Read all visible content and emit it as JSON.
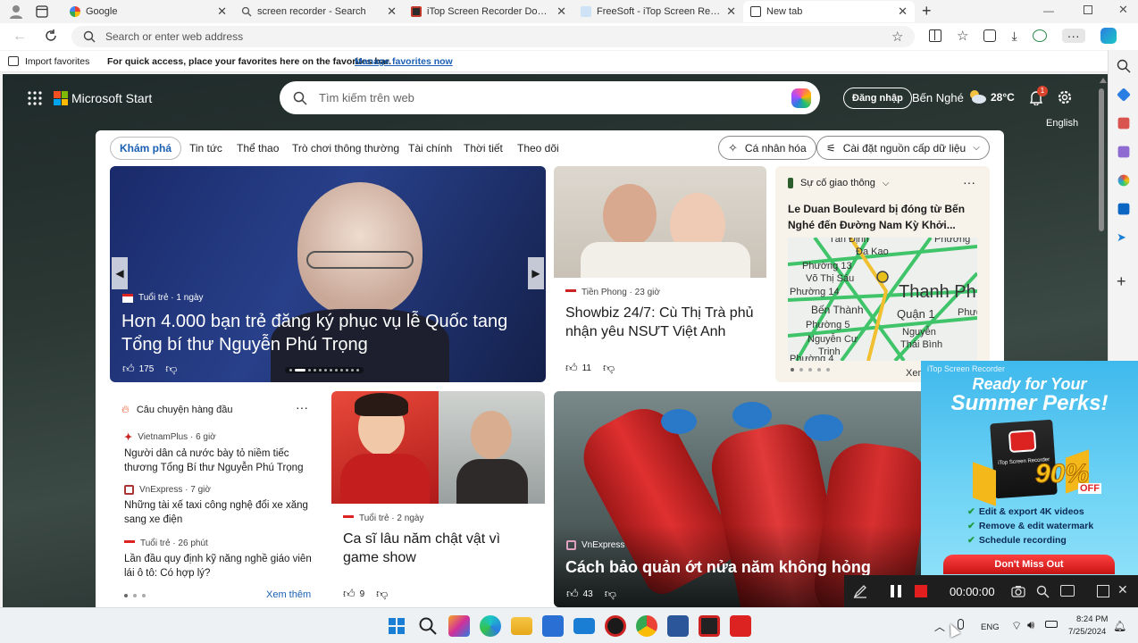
{
  "tabs": [
    {
      "title": "Google",
      "active": false
    },
    {
      "title": "screen recorder - Search",
      "active": false
    },
    {
      "title": "iTop Screen Recorder Download",
      "active": false
    },
    {
      "title": "FreeSoft - iTop Screen Recorder F",
      "active": false
    },
    {
      "title": "New tab",
      "active": true
    }
  ],
  "address_bar": {
    "placeholder": "Search or enter web address"
  },
  "favorites_bar": {
    "import_label": "Import favorites",
    "hint": "For quick access, place your favorites here on the favorites bar.",
    "manage_link": "Manage favorites now"
  },
  "msn": {
    "brand": "Microsoft Start",
    "search_placeholder": "Tìm kiếm trên web",
    "signin": "Đăng nhập",
    "location": "Bến Nghé",
    "temperature": "28°C",
    "notif_count": "1",
    "language": "English",
    "nav": [
      "Khám phá",
      "Tin tức",
      "Thể thao",
      "Trò chơi thông thường",
      "Tài chính",
      "Thời tiết",
      "Theo dõi"
    ],
    "personalize": "Cá nhân hóa",
    "feed_settings": "Cài đặt nguồn cấp dữ liệu",
    "hero": {
      "source": "Tuổi trẻ · 1 ngày",
      "title": "Hơn 4.000 bạn trẻ đăng ký phục vụ lễ Quốc tang Tổng bí thư Nguyễn Phú Trọng",
      "likes": "175"
    },
    "card2": {
      "source": "Tiền Phong · 23 giờ",
      "title": "Showbiz 24/7: Cù Thị Trà phủ nhận yêu NSƯT Việt Anh",
      "likes": "11"
    },
    "traffic": {
      "header": "Sự cố giao thông",
      "title": "Le Duan Boulevard bị đóng từ Bến Nghé đến Đường Nam Kỳ Khởi...",
      "map_labels": [
        "Tân Định",
        "Đa Kao",
        "Phường 13",
        "Võ Thị Sáu",
        "Phường",
        "Thanh Ph",
        "Bến Thành",
        "Quận 1",
        "Phườ",
        "Phường 5",
        "Nguyễn",
        "Nguyễn Cư",
        "Thái Bình",
        "Trinh",
        "Phường 14",
        "Phường 4"
      ],
      "more": "Xem"
    },
    "top_stories": {
      "header": "Câu chuyện hàng đầu",
      "items": [
        {
          "source": "VietnamPlus · 6 giờ",
          "title": "Người dân cả nước bày tỏ niềm tiếc thương Tổng Bí thư Nguyễn Phú Trọng"
        },
        {
          "source": "VnExpress · 7 giờ",
          "title": "Những tài xế taxi công nghệ đổi xe xăng sang xe điện"
        },
        {
          "source": "Tuổi trẻ · 26 phút",
          "title": "Lần đầu quy định kỹ năng nghề giáo viên lái ô tô: Có hợp lý?"
        }
      ],
      "see_more": "Xem thêm"
    },
    "card4": {
      "source": "Tuổi trẻ · 2 ngày",
      "title": "Ca sĩ lâu năm chật vật vì game show",
      "likes": "9"
    },
    "card5": {
      "source": "VnExpress",
      "title": "Cách bảo quản ớt nửa năm không hỏng",
      "likes": "43"
    }
  },
  "ad": {
    "brand": "iTop Screen Recorder",
    "headline1": "Ready for Your",
    "headline2": "Summer Perks!",
    "discount": "90%",
    "off": "OFF",
    "features": [
      "Edit & export 4K videos",
      "Remove & edit watermark",
      "Schedule recording"
    ],
    "cta": "Don't Miss Out",
    "box_label": "iTop Screen Recorder"
  },
  "recorder": {
    "timer": "00:00:00"
  },
  "taskbar": {
    "lang": "ENG",
    "time": "8:24 PM",
    "date": "7/25/2024"
  }
}
